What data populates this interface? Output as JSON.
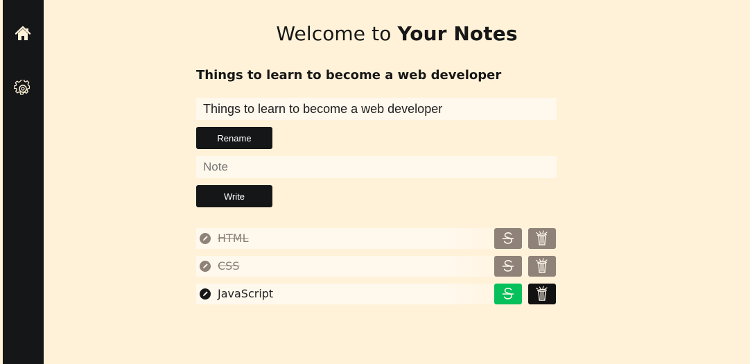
{
  "sidebar": {
    "home_icon": "home-icon",
    "settings_icon": "gear-icon"
  },
  "header": {
    "title_prefix": "Welcome to",
    "title_emphasis": "Your Notes"
  },
  "note": {
    "current_title": "Things to learn to become a web developer"
  },
  "form": {
    "title_value": "Things to learn to become a web developer",
    "rename_label": "Rename",
    "note_placeholder": "Note",
    "write_label": "Write"
  },
  "items": [
    {
      "label": "HTML",
      "status": "completed",
      "strike_icon": "strikethrough-icon",
      "delete_icon": "trash-icon"
    },
    {
      "label": "CSS",
      "status": "completed",
      "strike_icon": "strikethrough-icon",
      "delete_icon": "trash-icon"
    },
    {
      "label": "JavaScript",
      "status": "active",
      "strike_icon": "strikethrough-icon",
      "delete_icon": "trash-icon"
    }
  ],
  "colors": {
    "background": "#fff2d8",
    "sidebar": "#151617",
    "input_background": "#fff8ec",
    "completed_button": "#8f8278",
    "active_strike_button": "#05c05b",
    "active_delete_button": "#111111",
    "text": "#171717"
  }
}
